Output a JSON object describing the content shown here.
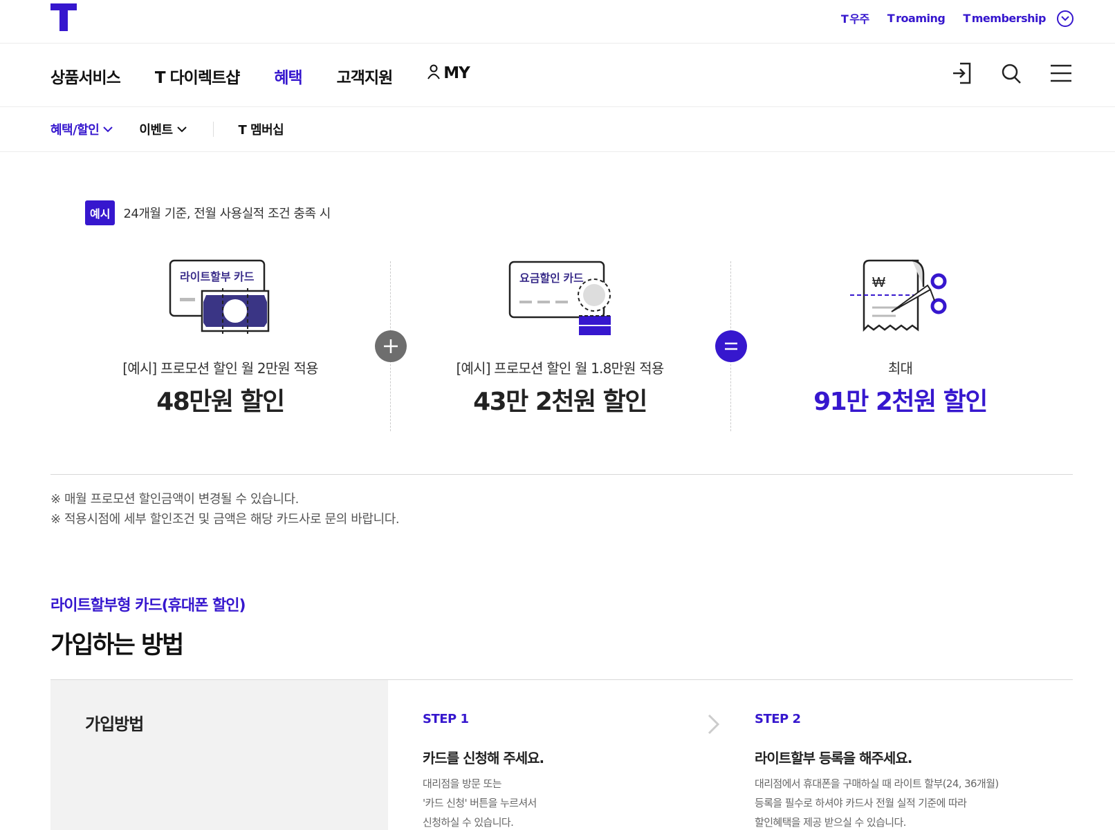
{
  "header": {
    "links": [
      {
        "mark": "T",
        "label": "우주"
      },
      {
        "mark": "T",
        "label": "roaming"
      },
      {
        "mark": "T",
        "label": "membership"
      }
    ]
  },
  "nav": {
    "items": [
      "상품서비스",
      "T 다이렉트샵",
      "혜택",
      "고객지원",
      "MY"
    ],
    "active": "혜택"
  },
  "subnav": {
    "items": [
      "혜택/할인",
      "이벤트",
      "T 멤버십"
    ]
  },
  "example": {
    "badge": "예시",
    "text": "24개월 기준, 전월 사용실적 조건 충족 시"
  },
  "benefits": [
    {
      "card_label": "라이트할부 카드",
      "caption": "[예시] 프로모션 할인 월 2만원 적용",
      "amount": "48만원 할인"
    },
    {
      "card_label": "요금할인 카드",
      "caption": "[예시] 프로모션 할인 월 1.8만원 적용",
      "amount": "43만 2천원 할인"
    },
    {
      "card_label": "₩",
      "caption": "최대",
      "amount": "91만 2천원 할인"
    }
  ],
  "notes": [
    "※ 매월 프로모션 할인금액이 변경될 수 있습니다.",
    "※ 적용시점에 세부 할인조건 및 금액은 해당 카드사로 문의 바랍니다."
  ],
  "section": {
    "subtitle": "라이트할부형 카드(휴대폰 할인)",
    "title": "가입하는 방법",
    "method_label": "가입방법",
    "steps": [
      {
        "num": "STEP 1",
        "head": "카드를 신청해 주세요.",
        "desc": [
          "대리점을 방문 또는",
          "'카드 신청' 버튼을 누르셔서",
          "신청하실 수 있습니다."
        ]
      },
      {
        "num": "STEP 2",
        "head": "라이트할부 등록을 해주세요.",
        "desc": [
          "대리점에서 휴대폰을 구매하실 때 라이트 할부(24, 36개월)",
          "등록을 필수로 하셔야 카드사 전월 실적 기준에 따라",
          "할인혜택을 제공 받으실 수 있습니다."
        ]
      }
    ]
  },
  "colors": {
    "brand": "#3617ce",
    "gray_op": "#6e6e6e"
  }
}
